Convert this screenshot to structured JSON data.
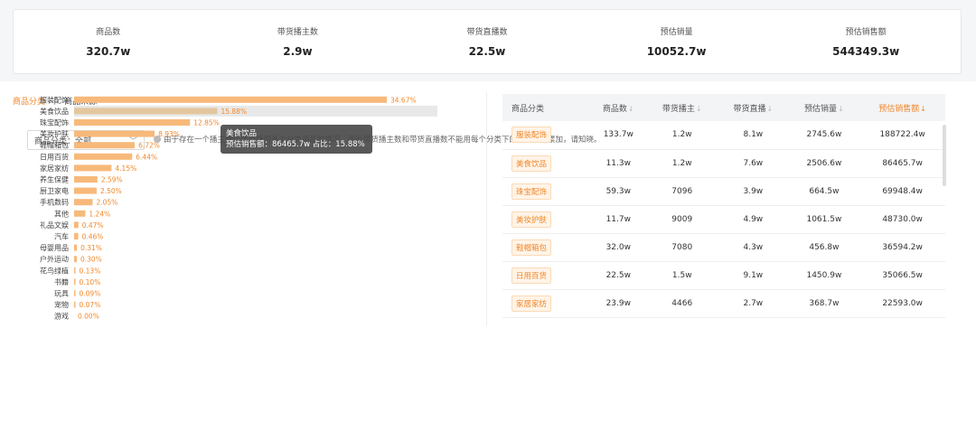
{
  "stats": [
    {
      "label": "商品数",
      "value": "320.7w"
    },
    {
      "label": "带货播主数",
      "value": "2.9w"
    },
    {
      "label": "带货直播数",
      "value": "22.5w"
    },
    {
      "label": "预估销量",
      "value": "10052.7w"
    },
    {
      "label": "预估销售额",
      "value": "544349.3w"
    }
  ],
  "tabs": {
    "active": "商品分类",
    "separator": "|",
    "other": "商品来源"
  },
  "filter": {
    "label": "商品分类：全部"
  },
  "notice": "由于存在一个播主或一场直播带多个分类商品的情况，因此带货播主数和带货直播数不能用每个分类下的数据进行累加，请知晓。",
  "colors": {
    "accent": "#f0882b",
    "bar": "#f7b97a",
    "highlight_bar": "#e2c79e",
    "hover_bg": "#e8e8e8"
  },
  "chart_data": {
    "type": "bar",
    "orientation": "horizontal",
    "categories": [
      "服装配饰",
      "美食饮品",
      "珠宝配饰",
      "美妆护肤",
      "鞋帽箱包",
      "日用百货",
      "家居家纺",
      "养生保健",
      "厨卫家电",
      "手机数码",
      "其他",
      "礼品文娱",
      "汽车",
      "母婴用品",
      "户外运动",
      "花鸟绿植",
      "书籍",
      "玩具",
      "宠物",
      "游戏"
    ],
    "values": [
      34.67,
      15.88,
      12.85,
      8.93,
      6.72,
      6.44,
      4.15,
      2.59,
      2.5,
      2.05,
      1.24,
      0.47,
      0.46,
      0.31,
      0.3,
      0.13,
      0.1,
      0.09,
      0.07,
      0.0
    ],
    "value_labels": [
      "34.67%",
      "15.88%",
      "12.85%",
      "8.93%",
      "6.72%",
      "6.44%",
      "4.15%",
      "2.59%",
      "2.50%",
      "2.05%",
      "1.24%",
      "0.47%",
      "0.46%",
      "0.31%",
      "0.30%",
      "0.13%",
      "0.10%",
      "0.09%",
      "0.07%",
      "0.00%"
    ],
    "highlight_index": 1,
    "xlim": [
      0,
      40
    ],
    "grid": false
  },
  "tooltip": {
    "title": "美食饮品",
    "line": "预估销售额：86465.7w 占比：15.88%"
  },
  "table": {
    "headers": [
      "商品分类",
      "商品数",
      "带货播主",
      "带货直播",
      "预估销量",
      "预估销售额"
    ],
    "sort_icon": "↓",
    "rows": [
      [
        "服装配饰",
        "133.7w",
        "1.2w",
        "8.1w",
        "2745.6w",
        "188722.4w"
      ],
      [
        "美食饮品",
        "11.3w",
        "1.2w",
        "7.6w",
        "2506.6w",
        "86465.7w"
      ],
      [
        "珠宝配饰",
        "59.3w",
        "7096",
        "3.9w",
        "664.5w",
        "69948.4w"
      ],
      [
        "美妆护肤",
        "11.7w",
        "9009",
        "4.9w",
        "1061.5w",
        "48730.0w"
      ],
      [
        "鞋帽箱包",
        "32.0w",
        "7080",
        "4.3w",
        "456.8w",
        "36594.2w"
      ],
      [
        "日用百货",
        "22.5w",
        "1.5w",
        "9.1w",
        "1450.9w",
        "35066.5w"
      ],
      [
        "家居家纺",
        "23.9w",
        "4466",
        "2.7w",
        "368.7w",
        "22593.0w"
      ]
    ]
  }
}
